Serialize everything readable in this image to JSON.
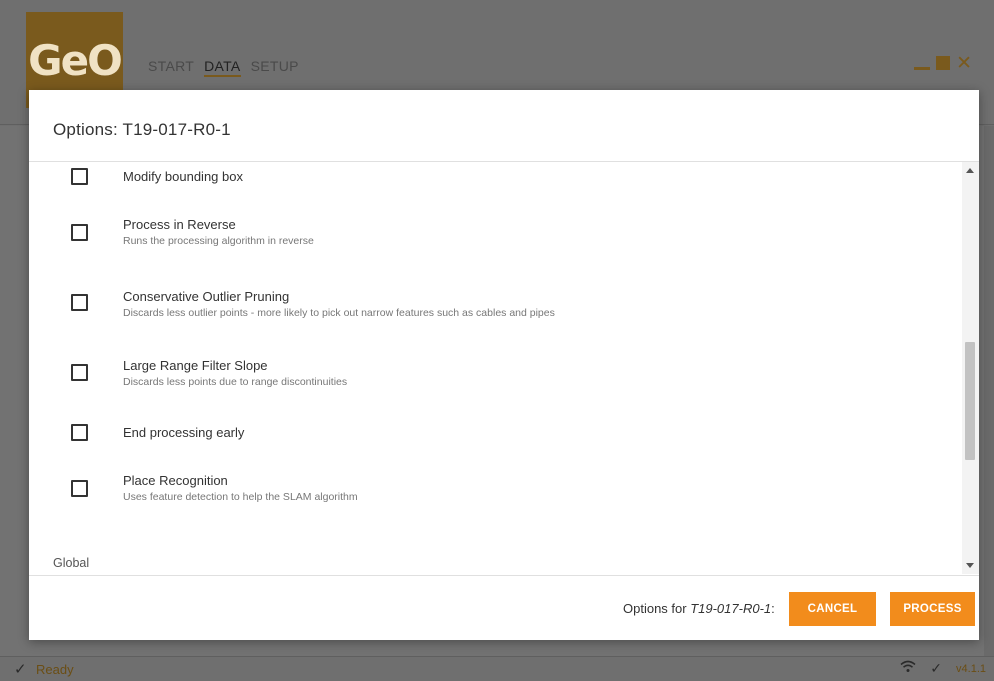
{
  "app": {
    "logo_text": "GeO",
    "nav": [
      "START",
      "DATA",
      "SETUP"
    ],
    "active_nav": "DATA",
    "status_text": "Ready",
    "version": "v4.1.1",
    "brand_color": "#f28c1c"
  },
  "dialog": {
    "title": "Options: T19-017-R0-1",
    "options": [
      {
        "label": "Modify bounding box",
        "description": "",
        "checked": false
      },
      {
        "label": "Process in Reverse",
        "description": "Runs the processing algorithm in reverse",
        "checked": false
      },
      {
        "label": "Conservative Outlier Pruning",
        "description": "Discards less outlier points - more likely to pick out narrow features such as cables and pipes",
        "checked": false
      },
      {
        "label": "Large Range Filter Slope",
        "description": "Discards less points due to range discontinuities",
        "checked": false
      },
      {
        "label": "End processing early",
        "description": "",
        "checked": false
      },
      {
        "label": "Place Recognition",
        "description": "Uses feature detection to help the SLAM algorithm",
        "checked": false
      }
    ],
    "section_global": "Global",
    "footer_prefix": "Options for ",
    "footer_target": "T19-017-R0-1",
    "footer_suffix": ":",
    "cancel_label": "CANCEL",
    "process_label": "PROCESS"
  }
}
